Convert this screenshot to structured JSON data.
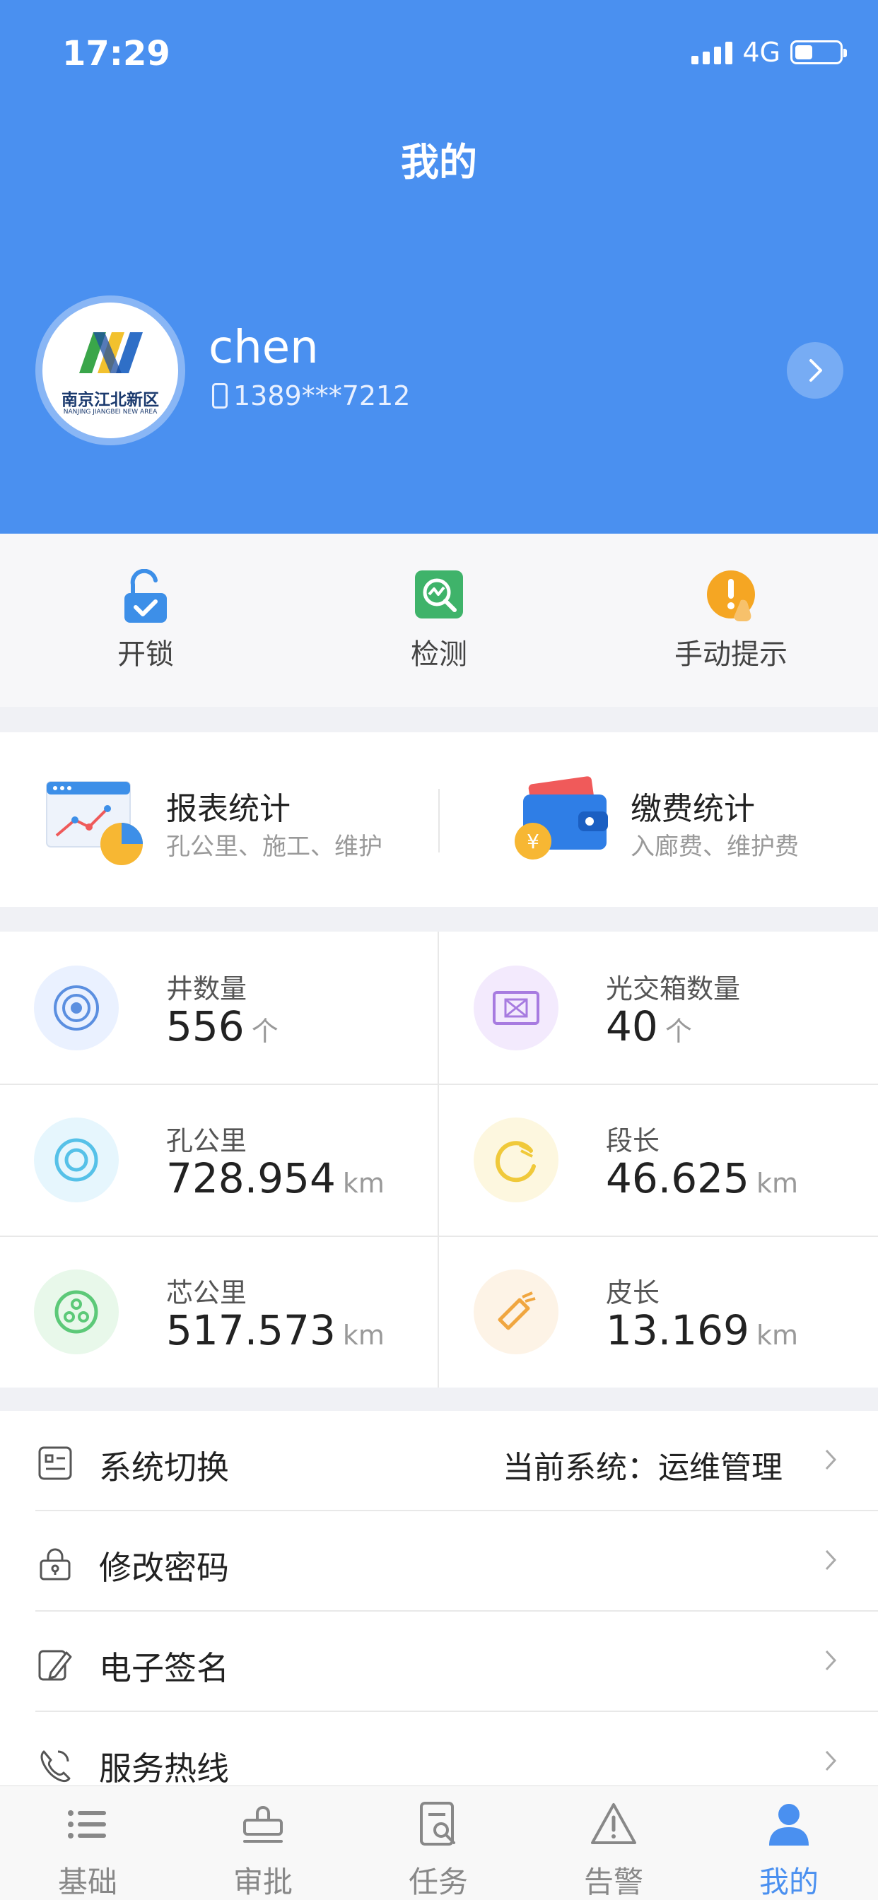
{
  "status_bar": {
    "time": "17:29",
    "network": "4G"
  },
  "header": {
    "title": "我的"
  },
  "profile": {
    "name": "chen",
    "phone": "1389***7212",
    "logo_text": "南京江北新区",
    "logo_sub": "NANJING JIANGBEI NEW AREA"
  },
  "quick_actions": [
    {
      "label": "开锁",
      "icon": "unlock-icon"
    },
    {
      "label": "检测",
      "icon": "detect-icon"
    },
    {
      "label": "手动提示",
      "icon": "manual-alert-icon"
    }
  ],
  "stat_cards": [
    {
      "title": "报表统计",
      "subtitle": "孔公里、施工、维护",
      "icon": "report-chart-icon"
    },
    {
      "title": "缴费统计",
      "subtitle": "入廊费、维护费",
      "icon": "wallet-icon"
    }
  ],
  "metrics": [
    {
      "label": "井数量",
      "value": "556",
      "unit": "个",
      "icon": "well-icon",
      "color": "#eaf1ff"
    },
    {
      "label": "光交箱数量",
      "value": "40",
      "unit": "个",
      "icon": "fiber-box-icon",
      "color": "#f3eafd"
    },
    {
      "label": "孔公里",
      "value": "728.954",
      "unit": "km",
      "icon": "hole-km-icon",
      "color": "#e6f6fd"
    },
    {
      "label": "段长",
      "value": "46.625",
      "unit": "km",
      "icon": "segment-icon",
      "color": "#fdf7df"
    },
    {
      "label": "芯公里",
      "value": "517.573",
      "unit": "km",
      "icon": "core-km-icon",
      "color": "#e8f8ea"
    },
    {
      "label": "皮长",
      "value": "13.169",
      "unit": "km",
      "icon": "sheath-icon",
      "color": "#fdf3e6"
    }
  ],
  "menu": [
    {
      "label": "系统切换",
      "value": "当前系统：运维管理",
      "icon": "system-switch-icon"
    },
    {
      "label": "修改密码",
      "value": "",
      "icon": "lock-icon"
    },
    {
      "label": "电子签名",
      "value": "",
      "icon": "signature-icon"
    },
    {
      "label": "服务热线",
      "value": "",
      "icon": "phone-icon"
    }
  ],
  "tabs": [
    {
      "label": "基础",
      "icon": "list-icon",
      "active": false
    },
    {
      "label": "审批",
      "icon": "stamp-icon",
      "active": false
    },
    {
      "label": "任务",
      "icon": "task-icon",
      "active": false
    },
    {
      "label": "告警",
      "icon": "warning-icon",
      "active": false
    },
    {
      "label": "我的",
      "icon": "user-icon",
      "active": true
    }
  ],
  "colors": {
    "primary": "#4a90f0"
  }
}
